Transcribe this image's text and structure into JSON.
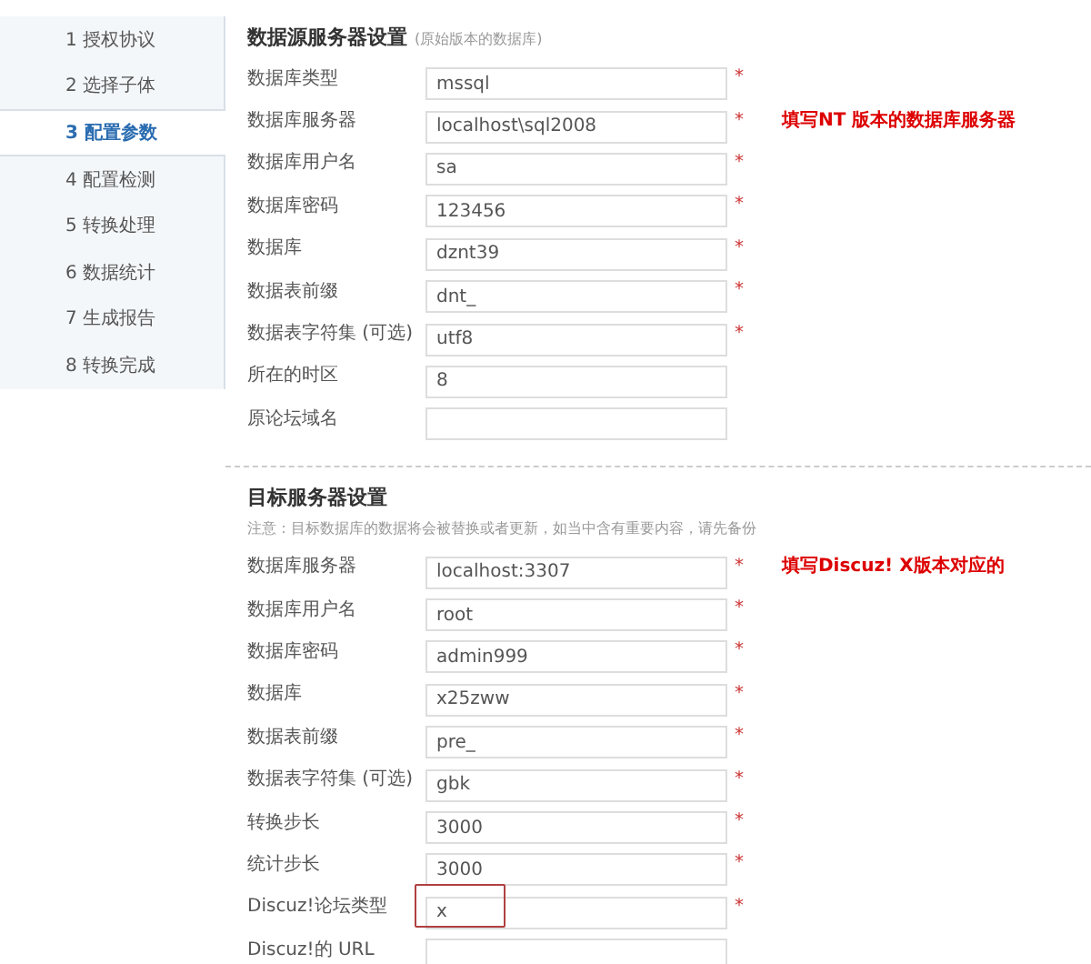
{
  "sidebar": {
    "steps": [
      {
        "label": "1 授权协议",
        "selected": false
      },
      {
        "label": "2 选择子体",
        "selected": false
      },
      {
        "label": "3 配置参数",
        "selected": true
      },
      {
        "label": "4 配置检测",
        "selected": false
      },
      {
        "label": "5 转换处理",
        "selected": false
      },
      {
        "label": "6 数据统计",
        "selected": false
      },
      {
        "label": "7 生成报告",
        "selected": false
      },
      {
        "label": "8 转换完成",
        "selected": false
      }
    ]
  },
  "sections": [
    {
      "title": "数据源服务器设置",
      "subtitle": "(原始版本的数据库)",
      "fields": [
        {
          "label": "数据库类型",
          "value": "mssql",
          "required_mark": "*"
        },
        {
          "label": "数据库服务器",
          "value": "localhost\\sql2008",
          "required_mark": "*",
          "annotation": "填写NT 版本的数据库服务器"
        },
        {
          "label": "数据库用户名",
          "value": "sa",
          "required_mark": "*"
        },
        {
          "label": "数据库密码",
          "value": "123456",
          "required_mark": "*"
        },
        {
          "label": "数据库",
          "value": "dznt39",
          "required_mark": "*"
        },
        {
          "label": "数据表前缀",
          "value": "dnt_",
          "required_mark": "*"
        },
        {
          "label": "数据表字符集 (可选)",
          "value": "utf8",
          "required_mark": "*"
        },
        {
          "label": "所在的时区",
          "value": "8"
        },
        {
          "label": "原论坛域名"
        }
      ]
    },
    {
      "title": "目标服务器设置",
      "note": "注意：目标数据库的数据将会被替换或者更新，如当中含有重要内容，请先备份",
      "fields": [
        {
          "label": "数据库服务器",
          "value": "localhost:3307",
          "required_mark": "*",
          "annotation": "填写Discuz! X版本对应的"
        },
        {
          "label": "数据库用户名",
          "value": "root",
          "required_mark": "*"
        },
        {
          "label": "数据库密码",
          "value": "admin999",
          "required_mark": "*"
        },
        {
          "label": "数据库",
          "value": "x25zww",
          "required_mark": "*"
        },
        {
          "label": "数据表前缀",
          "value": "pre_",
          "required_mark": "*"
        },
        {
          "label": "数据表字符集 (可选)",
          "value": "gbk",
          "required_mark": "*"
        },
        {
          "label": "转换步长",
          "value": "3000",
          "required_mark": "*"
        },
        {
          "label": "统计步长",
          "value": "3000",
          "required_mark": "*"
        },
        {
          "label": "Discuz!论坛类型",
          "value": "x",
          "required_mark": "*",
          "highlighted": true
        },
        {
          "label": "Discuz!的 URL"
        }
      ]
    }
  ]
}
